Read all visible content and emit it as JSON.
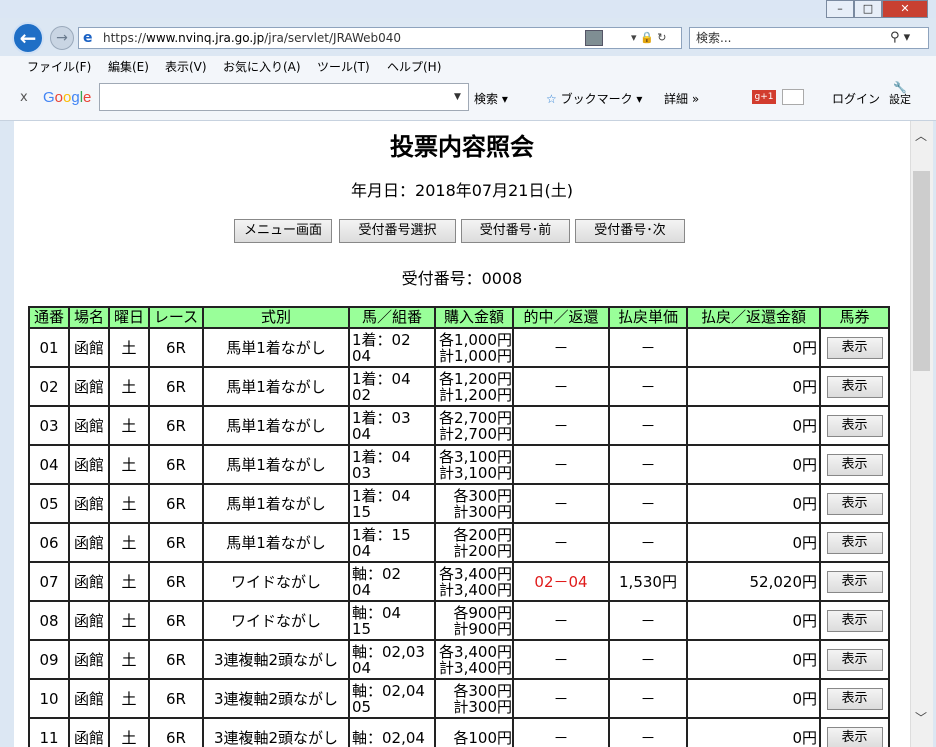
{
  "window": {
    "min": "–",
    "max": "□",
    "close": "✕"
  },
  "nav": {
    "back": "←",
    "forward": "→",
    "url_scheme": "https://",
    "url_host": "www.nvinq.jra.go.jp",
    "url_path": "/jra/servlet/JRAWeb040",
    "addr_icons": "▾ 🔒 ↻",
    "search_placeholder": "検索...",
    "search_icon": "⚲ ▾"
  },
  "menu": [
    "ファイル(F)",
    "編集(E)",
    "表示(V)",
    "お気に入り(A)",
    "ツール(T)",
    "ヘルプ(H)"
  ],
  "google": {
    "close": "x",
    "logo": "Google",
    "search": "検索 ▾",
    "bookmark": "ブックマーク ▾",
    "detail": "詳細 »",
    "plus": "g+1",
    "login": "ログイン",
    "settings": "設定"
  },
  "page": {
    "title": "投票内容照会",
    "date_line": "年月日：2018年07月21日(土)",
    "buttons": [
      "メニュー画面",
      "受付番号選択",
      "受付番号･前",
      "受付番号･次"
    ],
    "receipt_line": "受付番号：0008"
  },
  "table": {
    "headers": [
      "通番",
      "場名",
      "曜日",
      "レース",
      "式別",
      "馬／組番",
      "購入金額",
      "的中／返還",
      "払戻単価",
      "払戻／返還金額",
      "馬券"
    ],
    "rows": [
      {
        "no": "01",
        "venue": "函館",
        "day": "土",
        "race": "6R",
        "type": "馬単1着ながし",
        "bet1": "1着：02",
        "bet2": "04",
        "amt1": "各1,000円",
        "amt2": "計1,000円",
        "hit": "－",
        "unit": "－",
        "pay": "0円",
        "btn": "表示"
      },
      {
        "no": "02",
        "venue": "函館",
        "day": "土",
        "race": "6R",
        "type": "馬単1着ながし",
        "bet1": "1着：04",
        "bet2": "02",
        "amt1": "各1,200円",
        "amt2": "計1,200円",
        "hit": "－",
        "unit": "－",
        "pay": "0円",
        "btn": "表示"
      },
      {
        "no": "03",
        "venue": "函館",
        "day": "土",
        "race": "6R",
        "type": "馬単1着ながし",
        "bet1": "1着：03",
        "bet2": "04",
        "amt1": "各2,700円",
        "amt2": "計2,700円",
        "hit": "－",
        "unit": "－",
        "pay": "0円",
        "btn": "表示"
      },
      {
        "no": "04",
        "venue": "函館",
        "day": "土",
        "race": "6R",
        "type": "馬単1着ながし",
        "bet1": "1着：04",
        "bet2": "03",
        "amt1": "各3,100円",
        "amt2": "計3,100円",
        "hit": "－",
        "unit": "－",
        "pay": "0円",
        "btn": "表示"
      },
      {
        "no": "05",
        "venue": "函館",
        "day": "土",
        "race": "6R",
        "type": "馬単1着ながし",
        "bet1": "1着：04",
        "bet2": "15",
        "amt1": "各300円",
        "amt2": "計300円",
        "hit": "－",
        "unit": "－",
        "pay": "0円",
        "btn": "表示"
      },
      {
        "no": "06",
        "venue": "函館",
        "day": "土",
        "race": "6R",
        "type": "馬単1着ながし",
        "bet1": "1着：15",
        "bet2": "04",
        "amt1": "各200円",
        "amt2": "計200円",
        "hit": "－",
        "unit": "－",
        "pay": "0円",
        "btn": "表示"
      },
      {
        "no": "07",
        "venue": "函館",
        "day": "土",
        "race": "6R",
        "type": "ワイドながし",
        "bet1": "軸：02",
        "bet2": "04",
        "amt1": "各3,400円",
        "amt2": "計3,400円",
        "hit": "02－04",
        "unit": "1,530円",
        "pay": "52,020円",
        "btn": "表示"
      },
      {
        "no": "08",
        "venue": "函館",
        "day": "土",
        "race": "6R",
        "type": "ワイドながし",
        "bet1": "軸：04",
        "bet2": "15",
        "amt1": "各900円",
        "amt2": "計900円",
        "hit": "－",
        "unit": "－",
        "pay": "0円",
        "btn": "表示"
      },
      {
        "no": "09",
        "venue": "函館",
        "day": "土",
        "race": "6R",
        "type": "3連複軸2頭ながし",
        "bet1": "軸：02,03",
        "bet2": "04",
        "amt1": "各3,400円",
        "amt2": "計3,400円",
        "hit": "－",
        "unit": "－",
        "pay": "0円",
        "btn": "表示"
      },
      {
        "no": "10",
        "venue": "函館",
        "day": "土",
        "race": "6R",
        "type": "3連複軸2頭ながし",
        "bet1": "軸：02,04",
        "bet2": "05",
        "amt1": "各300円",
        "amt2": "計300円",
        "hit": "－",
        "unit": "－",
        "pay": "0円",
        "btn": "表示"
      },
      {
        "no": "11",
        "venue": "函館",
        "day": "土",
        "race": "6R",
        "type": "3連複軸2頭ながし",
        "bet1": "軸：02,04",
        "bet2": "",
        "amt1": "各100円",
        "amt2": "",
        "hit": "－",
        "unit": "－",
        "pay": "0円",
        "btn": "表示"
      }
    ]
  },
  "colors": {
    "header_bg": "#99ff99",
    "hit_text": "#e01b1b",
    "accent": "#1f6fc6"
  }
}
